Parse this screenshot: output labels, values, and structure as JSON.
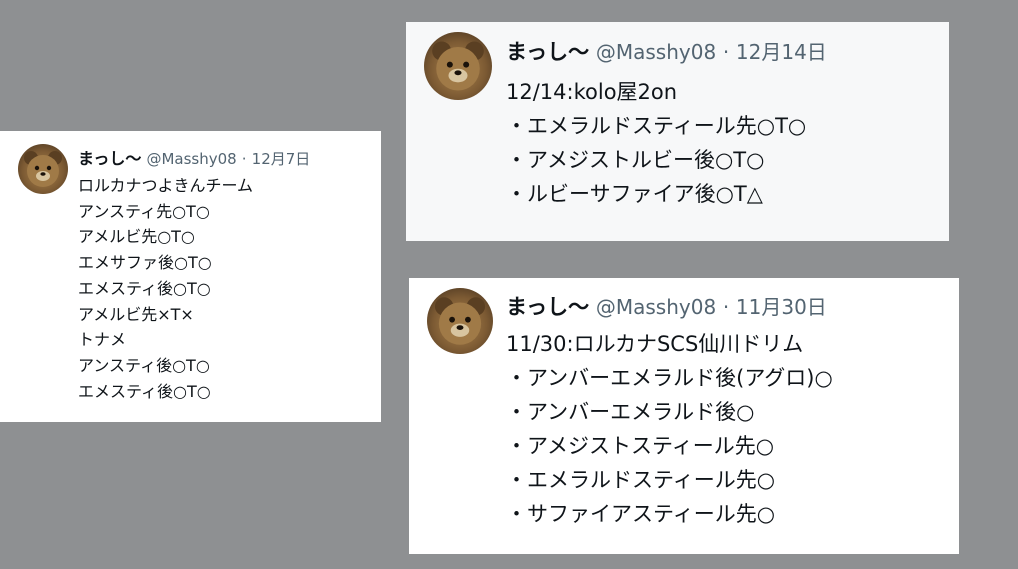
{
  "tweets": [
    {
      "name": "まっし〜",
      "handle": "@Masshy08",
      "separator": "·",
      "date": "12月7日",
      "avatar_icon": "bear-avatar-icon",
      "lines": [
        "ロルカナつよきんチーム",
        "アンスティ先○T○",
        "アメルビ先○T○",
        "エメサファ後○T○",
        "エメスティ後○T○",
        "アメルビ先×T×",
        "トナメ",
        "アンスティ後○T○",
        "エメスティ後○T○"
      ]
    },
    {
      "name": "まっし〜",
      "handle": "@Masshy08",
      "separator": "·",
      "date": "12月14日",
      "avatar_icon": "bear-avatar-icon",
      "lines": [
        "12/14:kolo屋2on",
        "・エメラルドスティール先○T○",
        "・アメジストルビー後○T○",
        "・ルビーサファイア後○T△"
      ]
    },
    {
      "name": "まっし〜",
      "handle": "@Masshy08",
      "separator": "·",
      "date": "11月30日",
      "avatar_icon": "bear-avatar-icon",
      "lines": [
        "11/30:ロルカナSCS仙川ドリム",
        "・アンバーエメラルド後(アグロ)○",
        "・アンバーエメラルド後○",
        "・アメジストスティール先○",
        "・エメラルドスティール先○",
        "・サファイアスティール先○"
      ]
    }
  ],
  "colors": {
    "background": "#8e9092",
    "card": "#ffffff",
    "card_alt": "#f7f8f9",
    "text": "#0f1419",
    "meta": "#536471"
  }
}
